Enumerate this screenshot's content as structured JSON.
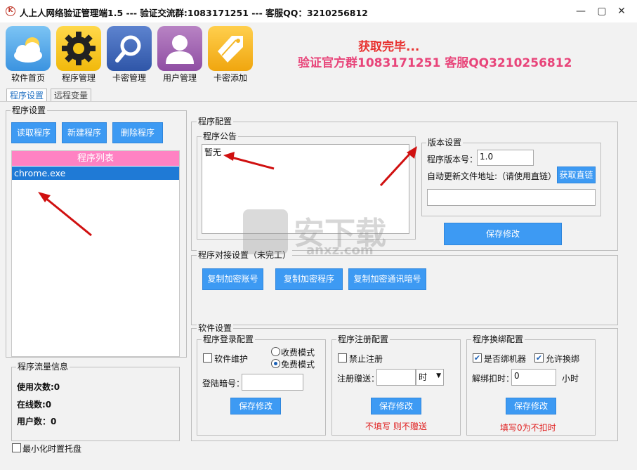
{
  "window": {
    "title": "人上人网络验证管理端1.5 --- 验证交流群:1083171251 --- 客服QQ：3210256812",
    "app_icon_glyph": "K",
    "minimize": "—",
    "maximize": "▢",
    "close": "✕"
  },
  "toolbar": [
    {
      "label": "软件首页",
      "icon": "cloud-sun-icon",
      "color": "#4aa3e8"
    },
    {
      "label": "程序管理",
      "icon": "gear-icon",
      "color": "#f5c518"
    },
    {
      "label": "卡密管理",
      "icon": "search-icon",
      "color": "#3f66b4"
    },
    {
      "label": "用户管理",
      "icon": "user-icon",
      "color": "#a865b5"
    },
    {
      "label": "卡密添加",
      "icon": "tags-icon",
      "color": "#f5b623"
    }
  ],
  "status": {
    "title": "获取完毕...",
    "line": "验证官方群1083171251 客服QQ3210256812"
  },
  "tabs": [
    {
      "label": "程序设置",
      "active": true
    },
    {
      "label": "远程变量",
      "active": false
    }
  ],
  "program_settings": {
    "group_label": "程序设置",
    "read_button": "读取程序",
    "new_button": "新建程序",
    "delete_button": "删除程序",
    "list_header": "程序列表",
    "list_items": [
      "chrome.exe"
    ],
    "selected_index": 0
  },
  "traffic": {
    "group_label": "程序流量信息",
    "usage": "使用次数:0",
    "online": "在线数:0",
    "users": "用户数：0"
  },
  "tray": {
    "label": "最小化时置托盘",
    "checked": false
  },
  "program_config": {
    "group_label": "程序配置",
    "notice_label": "程序公告",
    "notice_text": "暂无",
    "version": {
      "group_label": "版本设置",
      "version_label": "程序版本号：",
      "version_value": "1.0",
      "update_label": "自动更新文件地址:（请使用直链）",
      "fetch_button": "获取直链",
      "update_value": ""
    },
    "save_button": "保存修改"
  },
  "docking": {
    "group_label": "程序对接设置（未完工）",
    "copy_account": "复制加密账号",
    "copy_program": "复制加密程序",
    "copy_code": "复制加密通讯暗号"
  },
  "software": {
    "group_label": "软件设置",
    "login": {
      "group_label": "程序登录配置",
      "maintenance_label": "软件维护",
      "maintenance_checked": false,
      "paid_mode": "收费模式",
      "free_mode": "免费模式",
      "mode": "free",
      "code_label": "登陆暗号：",
      "code_value": "",
      "save_button": "保存修改"
    },
    "register": {
      "group_label": "程序注册配置",
      "forbid_label": "禁止注册",
      "forbid_checked": false,
      "gift_label": "注册赠送：",
      "gift_value": "",
      "unit": "时",
      "save_button": "保存修改",
      "note": "不填写 则不赠送"
    },
    "rebind": {
      "group_label": "程序换绑配置",
      "bind_label": "是否绑机器",
      "bind_checked": true,
      "allow_label": "允许换绑",
      "allow_checked": true,
      "deduct_label": "解绑扣时：",
      "deduct_value": "0",
      "deduct_unit": "小时",
      "save_button": "保存修改",
      "note": "填写0为不扣时"
    }
  },
  "watermark": {
    "text": "安下载",
    "site": "anxz.com"
  }
}
